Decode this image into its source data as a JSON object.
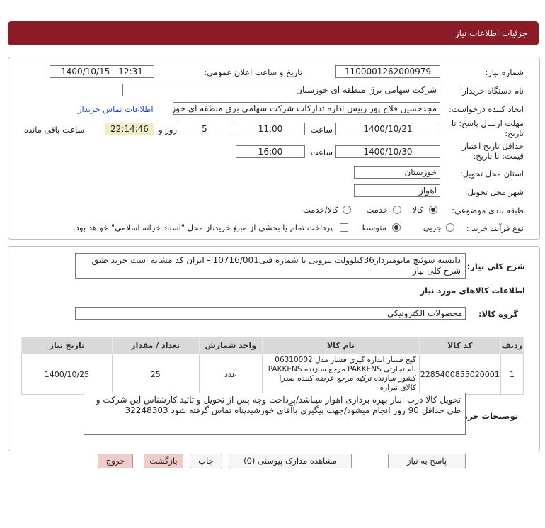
{
  "header": {
    "title": "جزئیات اطلاعات نیاز"
  },
  "form": {
    "need_number_label": "شماره نیاز:",
    "need_number": "1100001262000979",
    "announce_label": "تاریخ و ساعت اعلان عمومی:",
    "announce_value": "1400/10/15 - 12:31",
    "buyer_org_label": "نام دستگاه خریدار:",
    "buyer_org": "شرکت سهامی برق منطقه ای خوزستان",
    "creator_label": "ایجاد کننده درخواست:",
    "creator": "مجدحسین فلاح پور رییس اداره تدارکات شرکت سهامی برق منطقه ای خوزستان",
    "contact_link": "اطلاعات تماس خریدار",
    "reply_deadline_label_1": "مهلت ارسال پاسخ: تا",
    "reply_deadline_label_2": "تاریخ:",
    "reply_date": "1400/10/21",
    "time_label": "ساعت",
    "reply_time": "11:00",
    "days_value": "5",
    "days_label": "روز و",
    "remaining_time": "22:14:46",
    "remaining_label": "ساعت باقی مانده",
    "validity_label_1": "حداقل تاریخ اعتبار",
    "validity_label_2": "قیمت: تا تاریخ:",
    "validity_date": "1400/10/30",
    "validity_time": "16:00",
    "province_label": "استان محل تحویل:",
    "province": "خوزستان",
    "city_label": "شهر محل تحویل:",
    "city": "اهواز",
    "category_label": "طبقه بندی موضوعی:",
    "category_options": [
      "کالا",
      "خدمت",
      "کالا/خدمت"
    ],
    "purchase_type_label": "نوع فرآیند خرید :",
    "purchase_options": [
      "جزیی",
      "متوسط"
    ],
    "payment_note": "پرداخت تمام یا بخشی از مبلغ خرید،از محل \"اسناد خزانه اسلامی\" خواهد بود."
  },
  "summary": {
    "label": "شرح کلی نیاز:",
    "text": "دانسیه سوئیچ مانومتردار36کیلوولت بیرونی با شماره فنی10716/001 -  ایران کد مشابه است خرید طبق شرح کلی نیاز",
    "goods_info_title": "اطلاعات کالاهای مورد نیاز",
    "goods_group_label": "گروه کالا:",
    "goods_group": "محصولات الکترونیکی"
  },
  "table": {
    "headers": [
      "ردیف",
      "کد کالا",
      "نام کالا",
      "واحد شمارش",
      "تعداد / مقدار",
      "تاریخ نیاز"
    ],
    "rows": [
      {
        "row": "1",
        "code": "2285400855020001",
        "name": "گیج فشار اندازه گیری فشار مدل 06310002 نام تجارتی PAKKENS مرجع سازنده PAKKENS کشور سازنده ترکیه مرجع عرضه کننده صدرا کالای نیرازه",
        "unit": "عدد",
        "qty": "25",
        "date": "1400/10/25"
      }
    ]
  },
  "buyer_notes": {
    "label": "توضیحات خریدار:",
    "text": "تحویل کالا درب انبار بهره برداری اهواز میباشد/پرداخت وجه پس از تحویل و تائید کارشناس این شرکت و طی حداقل 90 روز انجام میشود/جهت پیگیری باآقای خورشیدپناه تماس گرفته شود 32248303"
  },
  "buttons": {
    "reply": "پاسخ به نیاز",
    "view_docs": "مشاهده مدارک پیوستی (0)",
    "print": "چاپ",
    "back": "بازگشت",
    "exit": "خروج"
  }
}
